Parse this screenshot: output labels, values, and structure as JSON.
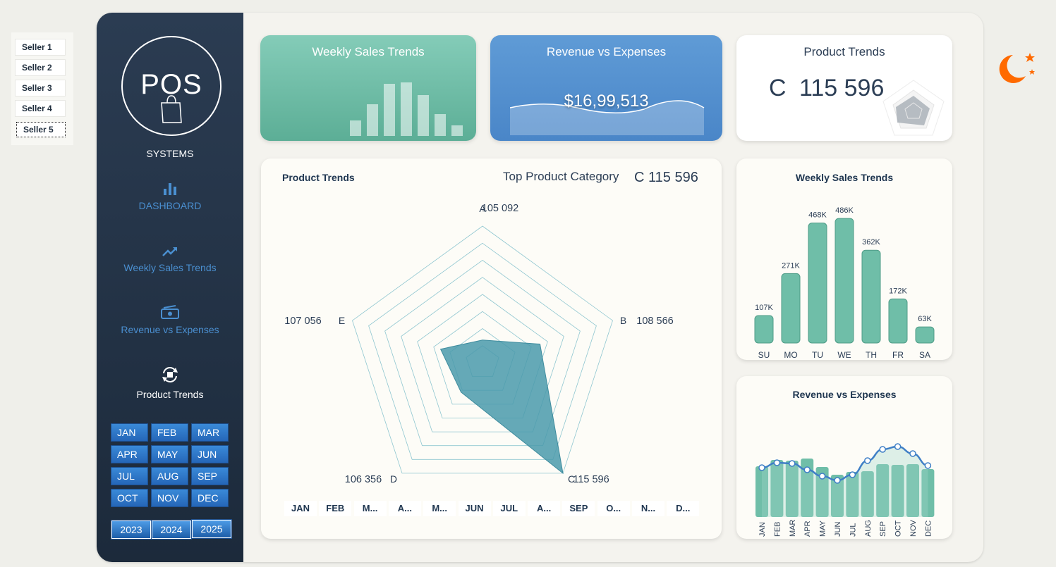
{
  "sellers": [
    "Seller 1",
    "Seller 2",
    "Seller 3",
    "Seller 4",
    "Seller 5"
  ],
  "logo": {
    "text": "POS",
    "subtitle": "SYSTEMS"
  },
  "nav": [
    {
      "label": "DASHBOARD",
      "icon": "bar-chart-icon"
    },
    {
      "label": "Weekly Sales Trends",
      "icon": "trend-up-icon"
    },
    {
      "label": "Revenue vs Expenses",
      "icon": "money-icon"
    },
    {
      "label": "Product Trends",
      "icon": "product-cycle-icon"
    }
  ],
  "months": [
    "JAN",
    "FEB",
    "MAR",
    "APR",
    "MAY",
    "JUN",
    "JUL",
    "AUG",
    "SEP",
    "OCT",
    "NOV",
    "DEC"
  ],
  "years": [
    "2023",
    "2024",
    "2025"
  ],
  "kpis": {
    "weekly": {
      "title": "Weekly Sales Trends",
      "bars": [
        22,
        45,
        74,
        76,
        58,
        31,
        15
      ]
    },
    "revenue": {
      "title": "Revenue vs Expenses",
      "value": "$16,99,513"
    },
    "product": {
      "title": "Product Trends",
      "category": "C",
      "value": "115 596"
    }
  },
  "radar": {
    "title": "Product Trends",
    "top_label": "Top Product Category",
    "top_value": "C 115 596",
    "axes": [
      {
        "name": "A",
        "value": 105092,
        "label": "105 092"
      },
      {
        "name": "B",
        "value": 108566,
        "label": "108 566"
      },
      {
        "name": "C",
        "value": 115596,
        "label": "115 596"
      },
      {
        "name": "D",
        "value": 106356,
        "label": "106 356"
      },
      {
        "name": "E",
        "value": 107056,
        "label": "107 056"
      }
    ],
    "month_slicer": [
      "JAN",
      "FEB",
      "M...",
      "A...",
      "M...",
      "JUN",
      "JUL",
      "A...",
      "SEP",
      "O...",
      "N...",
      "D..."
    ]
  },
  "chart_data": [
    {
      "type": "bar",
      "title": "Weekly Sales Trends",
      "categories": [
        "SU",
        "MO",
        "TU",
        "WE",
        "TH",
        "FR",
        "SA"
      ],
      "values": [
        107,
        271,
        468,
        486,
        362,
        172,
        63
      ],
      "labels": [
        "107K",
        "271K",
        "468K",
        "486K",
        "362K",
        "172K",
        "63K"
      ],
      "ylim": [
        0,
        500
      ]
    },
    {
      "type": "bar",
      "title": "Revenue vs Expenses",
      "categories": [
        "JAN",
        "FEB",
        "MAR",
        "APR",
        "MAY",
        "JUN",
        "JUL",
        "AUG",
        "SEP",
        "OCT",
        "NOV",
        "DEC"
      ],
      "series": [
        {
          "values": [
            72,
            81,
            80,
            83,
            71,
            60,
            64,
            65,
            75,
            74,
            75,
            68
          ]
        },
        {
          "values": [
            70,
            77,
            76,
            67,
            58,
            52,
            60,
            80,
            96,
            100,
            90,
            73
          ]
        }
      ],
      "ylim": [
        0,
        110
      ]
    }
  ],
  "colors": {
    "teal": "#5fb39c",
    "blue": "#4a8fd0",
    "navy": "#1f2d3d",
    "radar": "#4a9aab",
    "moon": "#ff6a00"
  }
}
